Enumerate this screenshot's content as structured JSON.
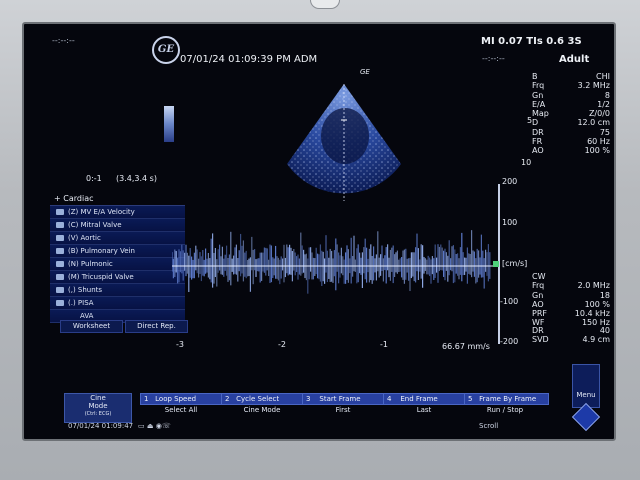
{
  "header": {
    "top_left": "--:--:--",
    "datetime": "07/01/24 01:09:39 PM ADM",
    "mi_tis": "MI 0.07  TIs 0.6  3S",
    "right_sub": "--:--:--",
    "preset": "Adult",
    "logo": "GE"
  },
  "sector_label": "GE",
  "ratio": {
    "left": "0:-1",
    "right": "(3.4,3.4 s)"
  },
  "measure_menu": {
    "title": "Cardiac",
    "items": [
      "(Z)  MV E/A Velocity",
      "(C)  Mitral Valve",
      "(V)  Aortic",
      "(B)  Pulmonary Vein",
      "(N)  Pulmonic",
      "(M)  Tricuspid Valve",
      "(,)  Shunts",
      "(.)  PISA",
      "AVA"
    ],
    "worksheet": "Worksheet",
    "direct_rep": "Direct Rep."
  },
  "params_b": [
    {
      "k": "B",
      "v": "CHI"
    },
    {
      "k": "Frq",
      "v": "3.2 MHz"
    },
    {
      "k": "Gn",
      "v": "8"
    },
    {
      "k": "E/A",
      "v": "1/2"
    },
    {
      "k": "Map",
      "v": "Z/0/0"
    },
    {
      "k": "D",
      "v": "12.0 cm"
    },
    {
      "k": "DR",
      "v": "75"
    },
    {
      "k": "FR",
      "v": "60 Hz"
    },
    {
      "k": "AO",
      "v": "100 %"
    }
  ],
  "depth_marks": [
    "5",
    "10"
  ],
  "params_cw": [
    {
      "k": "CW",
      "v": ""
    },
    {
      "k": "Frq",
      "v": "2.0 MHz"
    },
    {
      "k": "Gn",
      "v": "18"
    },
    {
      "k": "AO",
      "v": "100 %"
    },
    {
      "k": "PRF",
      "v": "10.4 kHz"
    },
    {
      "k": "WF",
      "v": "150 Hz"
    }
  ],
  "params_dr": [
    {
      "k": "DR",
      "v": "40"
    },
    {
      "k": "SVD",
      "v": "4.9 cm"
    }
  ],
  "doppler": {
    "scale_labels": [
      "200",
      "100",
      "[cm/s]",
      "-100",
      "-200"
    ],
    "time_labels": [
      "-3",
      "-2",
      "-1"
    ],
    "sweep": "66.67 mm/s"
  },
  "softkeys": {
    "cine": [
      "Cine",
      "Mode",
      "(Ctrl: ECG)"
    ],
    "top": [
      "Loop Speed",
      "Cycle Select",
      "Start Frame",
      "End Frame",
      "Frame By Frame"
    ],
    "top_nums": [
      "1",
      "2",
      "3",
      "4",
      "5"
    ],
    "bottom": [
      "Select All",
      "Cine Mode",
      "First",
      "Last",
      "Run / Stop"
    ]
  },
  "status": {
    "datetime": "07/01/24 01:09:47",
    "scroll": "Scroll",
    "menu": "Menu"
  }
}
